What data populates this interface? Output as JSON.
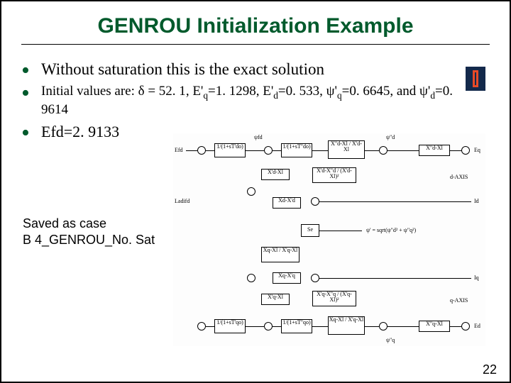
{
  "title": "GENROU Initialization Example",
  "bullets": {
    "b1": "Without saturation this is the exact solution",
    "b2_prefix": "Initial values are: δ = 52. 1",
    "b2_mid": "E'",
    "b2_eq_val": "=1. 1298, E'",
    "b2_ed_val": "=0. 533, ψ'",
    "b2_psiq_val": "=0. 6645, and ψ'",
    "b2_psid_val": "=0. 9614",
    "b3": "Efd=2. 9133"
  },
  "subs": {
    "q": "q",
    "d": "d"
  },
  "caption_line1": "Saved as case",
  "caption_line2": "B 4_GENROU_No. Sat",
  "page_number": "22",
  "diagram": {
    "top_labels": {
      "psi_fd": "ψfd",
      "psi_d": "ψ\"d",
      "eq": "Eq"
    },
    "left_labels": {
      "efd": "Efd",
      "ladifd": "Ladifd"
    },
    "right_label": "Id",
    "mid_labels": {
      "dAXIS": "d-AXIS",
      "xpd_xl": "X'd-Xl",
      "xppd_xl": "X\"d-Xl",
      "se": "Se",
      "psi_prime": "ψ' = sqrt(ψ\"d² + ψ\"q²)",
      "xq_xl": "Xq-X'l",
      "xpq_xl": "X'q-Xl",
      "qAXIS": "q-AXIS"
    },
    "bottom_labels": {
      "psi_q": "ψ\"q",
      "ed": "Ed",
      "iq": "Iq"
    },
    "tf_boxes": [
      "1/(1+sT'do)",
      "1/(1+sT\"do)",
      "X\"d-Xl / X'd-Xl",
      "X'd-Xl",
      "X'd-X\"d / (X'd-Xl)²",
      "Xd-X'd",
      "Xq-Xl / X'q-Xl",
      "X'q-Xl",
      "X'q-X\"q / (X'q-Xl)²",
      "Xq-X'q",
      "1/(1+sT\"qo)",
      "1/(1+sT'qo)"
    ]
  },
  "icons": {
    "logo": "illinois-block-i"
  }
}
